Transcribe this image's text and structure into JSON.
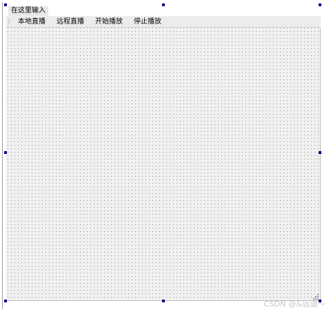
{
  "menubar": {
    "input_placeholder": "在这里输入"
  },
  "toolbar": {
    "items": [
      {
        "label": "本地直播"
      },
      {
        "label": "远程直播"
      },
      {
        "label": "开始播放"
      },
      {
        "label": "停止播放"
      }
    ]
  },
  "watermark": {
    "text": "CSDN @&远道～"
  },
  "colors": {
    "canvas_bg": "#f0f0f0",
    "grid_dot": "#8f8f8f",
    "handle": "#00008b",
    "toolbar_bg": "#ececec",
    "watermark": "#c6c6c6"
  }
}
